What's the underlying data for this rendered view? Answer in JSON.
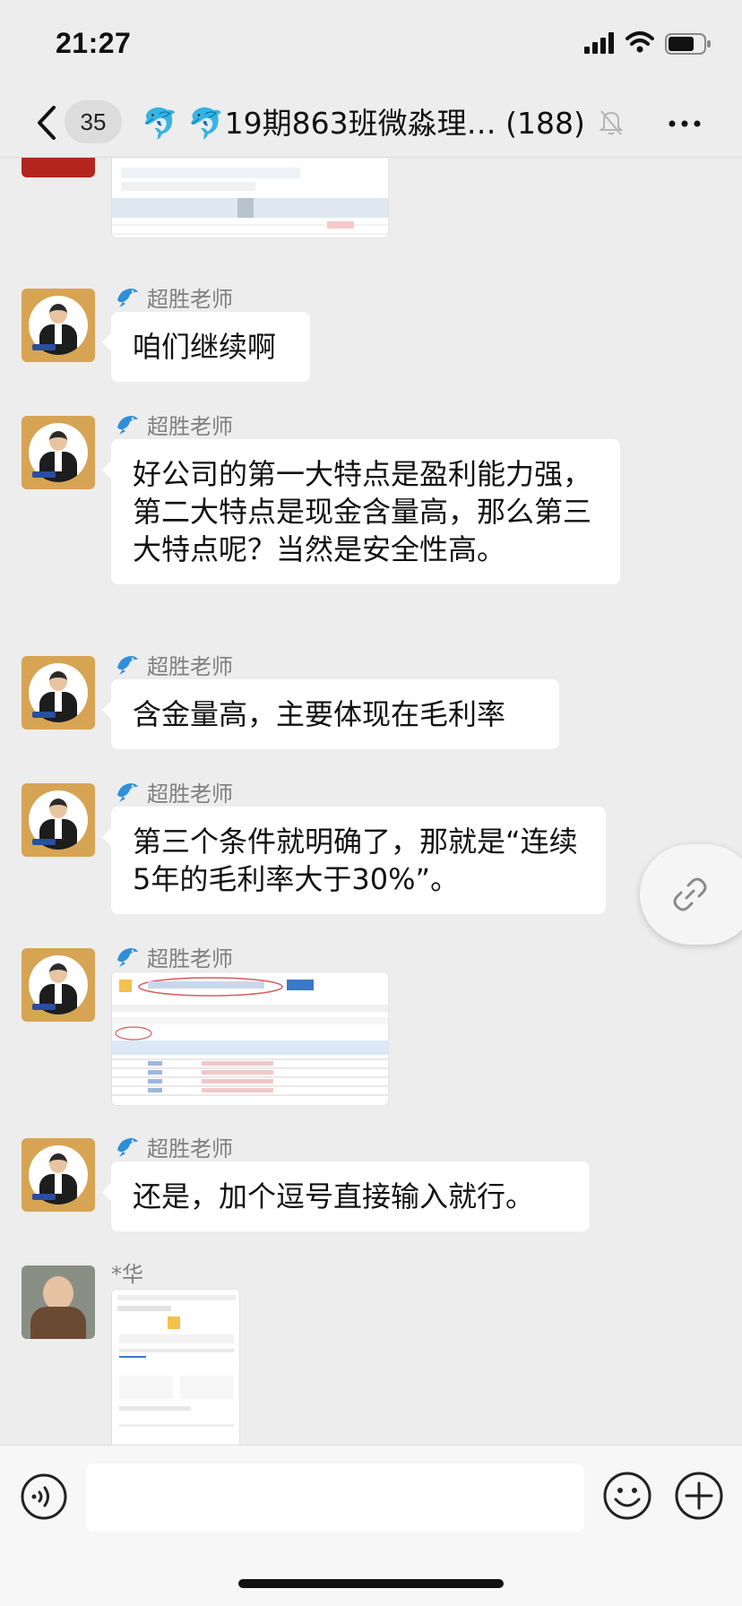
{
  "status_bar": {
    "time": "21:27"
  },
  "header": {
    "unread_count": "35",
    "title": "🐬 🐬19期863班微淼理… (188)"
  },
  "messages": [
    {
      "sender": "超胜老师",
      "type": "text",
      "text": "咱们继续啊"
    },
    {
      "sender": "超胜老师",
      "type": "text",
      "text": "好公司的第一大特点是盈利能力强，第二大特点是现金含量高，那么第三大特点呢？当然是安全性高。"
    },
    {
      "sender": "超胜老师",
      "type": "text",
      "text": "含金量高，主要体现在毛利率"
    },
    {
      "sender": "超胜老师",
      "type": "text",
      "text": "第三个条件就明确了，那就是“连续5年的毛利率大于30%”。"
    },
    {
      "sender": "超胜老师",
      "type": "image"
    },
    {
      "sender": "超胜老师",
      "type": "text",
      "text": "还是，加个逗号直接输入就行。"
    },
    {
      "sender": "*华",
      "type": "image"
    }
  ],
  "icons": {
    "back": "chevron-left-icon",
    "mute": "bell-off-icon",
    "more": "more-dots-icon",
    "link": "link-icon",
    "voice": "voice-icon",
    "emoji": "emoji-icon",
    "plus": "plus-circle-icon"
  },
  "colors": {
    "background": "#ededed",
    "bubble": "#ffffff",
    "sender": "#808080"
  }
}
